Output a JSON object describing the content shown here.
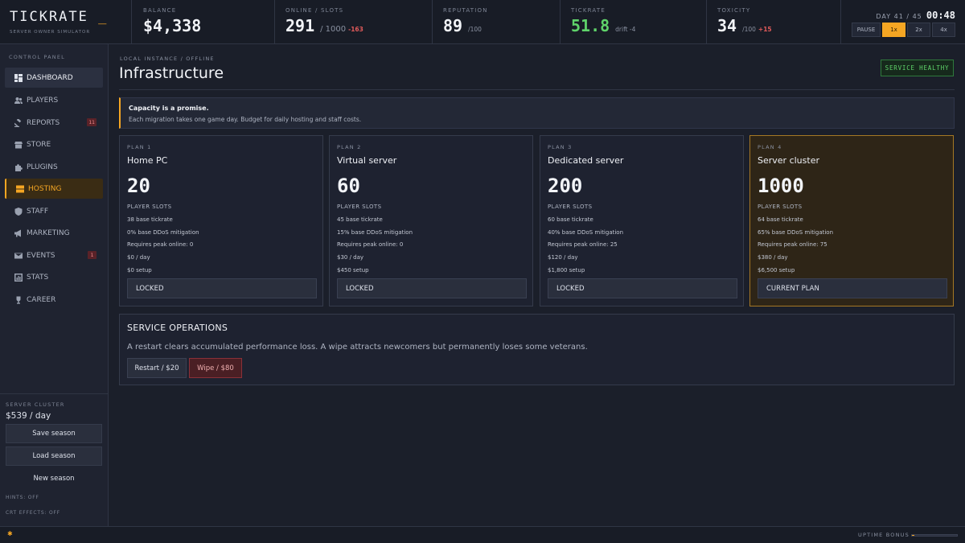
{
  "app": {
    "title": "TICKRATE",
    "cursor": "_",
    "subtitle": "SERVER OWNER SIMULATOR"
  },
  "stats": {
    "balance": {
      "label": "BALANCE",
      "value": "$4,338"
    },
    "online": {
      "label": "ONLINE / SLOTS",
      "value": "291",
      "sub": "/ 1000",
      "delta": "-163"
    },
    "reputation": {
      "label": "REPUTATION",
      "value": "89",
      "sub": "/100"
    },
    "tickrate": {
      "label": "TICKRATE",
      "value": "51.8",
      "sub": "drift -4"
    },
    "toxicity": {
      "label": "TOXICITY",
      "value": "34",
      "sub": "/100",
      "delta": "+15"
    }
  },
  "time": {
    "day_label": "DAY 41 / 45",
    "clock": "00:48",
    "speeds": [
      "PAUSE",
      "1x",
      "2x",
      "4x"
    ],
    "active_speed": "1x"
  },
  "sidebar": {
    "heading": "CONTROL PANEL",
    "items": [
      {
        "label": "DASHBOARD",
        "icon": "dashboard-icon"
      },
      {
        "label": "PLAYERS",
        "icon": "players-icon"
      },
      {
        "label": "REPORTS",
        "icon": "gavel-icon",
        "badge": "11"
      },
      {
        "label": "STORE",
        "icon": "store-icon"
      },
      {
        "label": "PLUGINS",
        "icon": "puzzle-icon"
      },
      {
        "label": "HOSTING",
        "icon": "server-icon"
      },
      {
        "label": "STAFF",
        "icon": "shield-icon"
      },
      {
        "label": "MARKETING",
        "icon": "megaphone-icon"
      },
      {
        "label": "EVENTS",
        "icon": "mail-icon",
        "badge": "1"
      },
      {
        "label": "STATS",
        "icon": "bar-chart-icon"
      },
      {
        "label": "CAREER",
        "icon": "trophy-icon"
      }
    ],
    "active_item": "DASHBOARD",
    "selected_item": "HOSTING",
    "cluster_label": "SERVER CLUSTER",
    "cluster_cost": "$539 / day",
    "save": "Save season",
    "load": "Load season",
    "new": "New season",
    "hints": "HINTS: OFF",
    "crt": "CRT EFFECTS: OFF"
  },
  "main": {
    "breadcrumb": "LOCAL INSTANCE / OFFLINE",
    "title": "Infrastructure",
    "status": "SERVICE HEALTHY",
    "callout": {
      "title": "Capacity is a promise.",
      "body": "Each migration takes one game day. Budget for daily hosting and staff costs."
    },
    "plans": [
      {
        "label": "PLAN 1",
        "name": "Home PC",
        "slots": "20",
        "slots_label": "PLAYER SLOTS",
        "tickrate": "38 base tickrate",
        "ddos": "0% base DDoS mitigation",
        "peak": "Requires peak online: 0",
        "daily": "$0 / day",
        "setup": "$0 setup",
        "button": "LOCKED"
      },
      {
        "label": "PLAN 2",
        "name": "Virtual server",
        "slots": "60",
        "slots_label": "PLAYER SLOTS",
        "tickrate": "45 base tickrate",
        "ddos": "15% base DDoS mitigation",
        "peak": "Requires peak online: 0",
        "daily": "$30 / day",
        "setup": "$450 setup",
        "button": "LOCKED"
      },
      {
        "label": "PLAN 3",
        "name": "Dedicated server",
        "slots": "200",
        "slots_label": "PLAYER SLOTS",
        "tickrate": "60 base tickrate",
        "ddos": "40% base DDoS mitigation",
        "peak": "Requires peak online: 25",
        "daily": "$120 / day",
        "setup": "$1,800 setup",
        "button": "LOCKED"
      },
      {
        "label": "PLAN 4",
        "name": "Server cluster",
        "slots": "1000",
        "slots_label": "PLAYER SLOTS",
        "tickrate": "64 base tickrate",
        "ddos": "65% base DDoS mitigation",
        "peak": "Requires peak online: 75",
        "daily": "$380 / day",
        "setup": "$6,500 setup",
        "button": "CURRENT PLAN"
      }
    ],
    "current_plan_index": 3,
    "ops": {
      "title": "SERVICE OPERATIONS",
      "body": "A restart clears accumulated performance loss. A wipe attracts newcomers but permanently loses some veterans.",
      "restart": "Restart / $20",
      "wipe": "Wipe / $80"
    }
  },
  "footer": {
    "uptime_label": "UPTIME BONUS",
    "uptime_fill": 0.05,
    "indicator_icon": "status-star-icon"
  },
  "colors": {
    "accent": "#f5a623",
    "healthy": "#5fd36a",
    "danger": "#e05a5a",
    "background": "#1b1f2a"
  }
}
